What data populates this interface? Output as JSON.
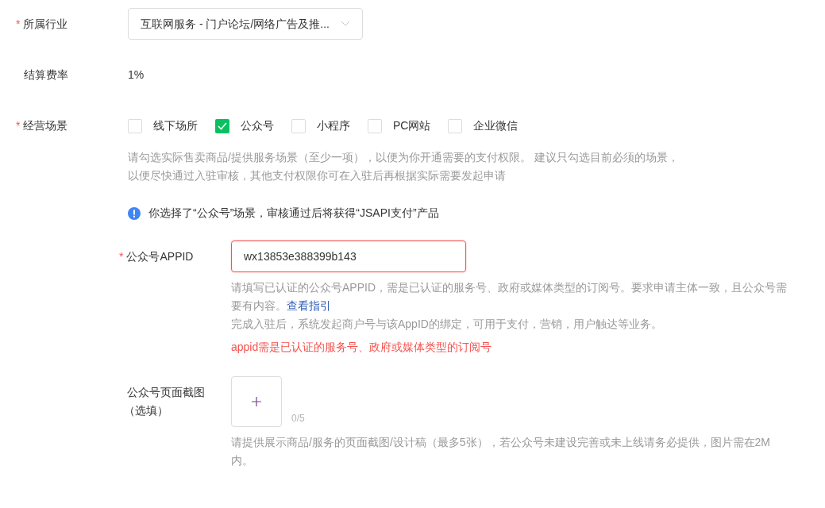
{
  "industry": {
    "label": "所属行业",
    "required_mark": "*",
    "value": "互联网服务 - 门户论坛/网络广告及推..."
  },
  "fee": {
    "label": "结算费率",
    "value": "1%"
  },
  "scenes": {
    "label": "经营场景",
    "required_mark": "*",
    "options": [
      {
        "label": "线下场所",
        "checked": false
      },
      {
        "label": "公众号",
        "checked": true
      },
      {
        "label": "小程序",
        "checked": false
      },
      {
        "label": "PC网站",
        "checked": false
      },
      {
        "label": "企业微信",
        "checked": false
      }
    ],
    "help": [
      "请勾选实际售卖商品/提供服务场景（至少一项），以便为你开通需要的支付权限。 建议只勾选目前必须的场景，",
      "以便尽快通过入驻审核，其他支付权限你可在入驻后再根据实际需要发起申请"
    ],
    "notice": "你选择了“公众号”场景，审核通过后将获得“JSAPI支付”产品"
  },
  "appid": {
    "label": "公众号APPID",
    "required_mark": "*",
    "value": "wx13853e388399b143",
    "error": true,
    "help": "请填写已认证的公众号APPID，需是已认证的服务号、政府或媒体类型的订阅号。要求申请主体一致，且公众号需要有内容。",
    "link": "查看指引",
    "help2": "完成入驻后，系统发起商户号与该AppID的绑定，可用于支付，营销，用户触达等业务。",
    "error_text": "appid需是已认证的服务号、政府或媒体类型的订阅号"
  },
  "screenshot": {
    "label": "公众号页面截图",
    "label2": "（选填）",
    "count": "0/5",
    "help": "请提供展示商品/服务的页面截图/设计稿（最多5张），若公众号未建设完善或未上线请务必提供，图片需在2M内。"
  }
}
